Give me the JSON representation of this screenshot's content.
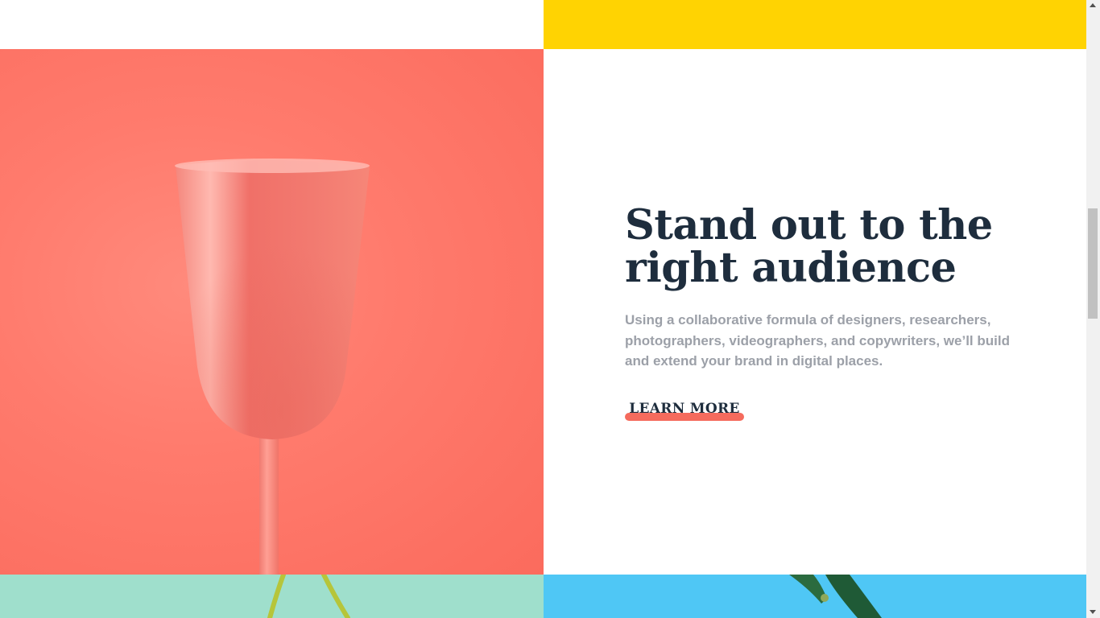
{
  "feature": {
    "heading": "Stand out to the right audience",
    "description": "Using a collaborative formula of designers, researchers, photographers, videographers, and copywriters, we’ll build and extend your brand in digital places.",
    "cta_label": "LEARN MORE"
  },
  "colors": {
    "yellow_panel": "#ffd302",
    "coral_panel": "#ff7b6d",
    "mint_panel": "#9fdfcc",
    "blue_panel": "#4fc7f5",
    "heading_text": "#1e2d3d",
    "body_text": "#9ca0a8",
    "cta_underline": "#f56b5d"
  },
  "images": {
    "coral_panel": "pink-goblet-image",
    "mint_panel": "plant-stems-image",
    "blue_panel": "green-leaf-image"
  },
  "scrollbar": {
    "position": 0.35
  }
}
